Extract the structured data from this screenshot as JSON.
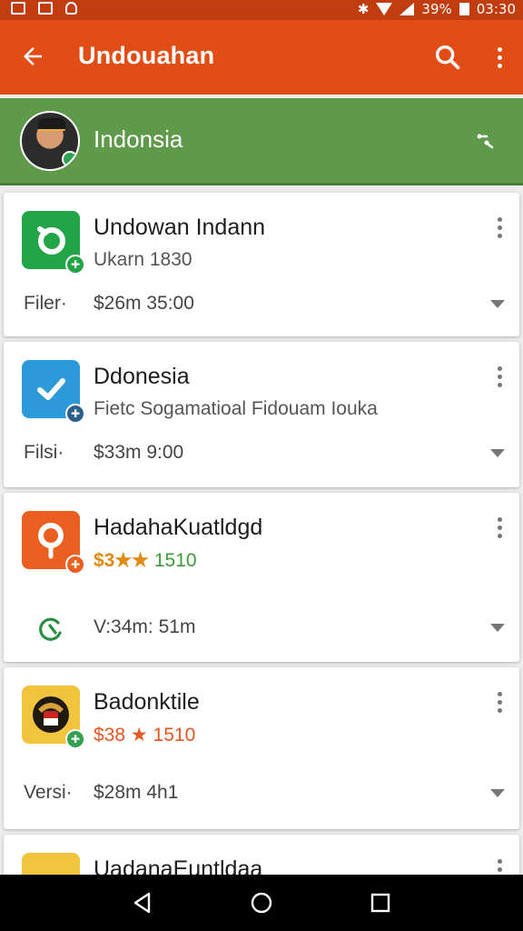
{
  "status_bar": {
    "battery": "39%",
    "time": "03:30",
    "icons": [
      "image-icon",
      "image-icon",
      "debug-icon",
      "bug-icon",
      "wifi-icon",
      "signal-icon",
      "battery-icon"
    ]
  },
  "app_bar": {
    "title": "Undouahan",
    "back_icon": "arrow-back-icon",
    "search_icon": "search-icon",
    "more_icon": "more-vertical-icon",
    "color": "#e24d15"
  },
  "country": {
    "name": "Indonsia",
    "color": "#5f9a4b"
  },
  "apps": [
    {
      "name": "Undowan Indann",
      "subtitle": "Ukarn 1830",
      "meta_label": "Filer·",
      "meta_value": "$26m 35:00",
      "icon_color": "#21a546",
      "icon_name": "bubble-icon"
    },
    {
      "name": "Ddonesia",
      "subtitle": "Fietc Sogamatioal Fidouam Iouka",
      "meta_label": "Filsi·",
      "meta_value": "$33m 9:00",
      "icon_color": "#2c9ad9",
      "icon_name": "check-icon"
    },
    {
      "name": "HadahaKuatldgd",
      "rating_prefix": "$3★★",
      "rating_value": "1510",
      "meta_label": "",
      "meta_value": "V:34m: 51m",
      "icon_color": "#ec5f21",
      "icon_name": "location-pin-icon"
    },
    {
      "name": "Badonktile",
      "rating_prefix": "$38",
      "rating_value": "★ 1510",
      "meta_label": "Versi·",
      "meta_value": "$28m 4h1",
      "icon_color": "#f2c33d",
      "icon_name": "garuda-emblem-icon"
    },
    {
      "name": "UadanaEuntldaa"
    }
  ]
}
